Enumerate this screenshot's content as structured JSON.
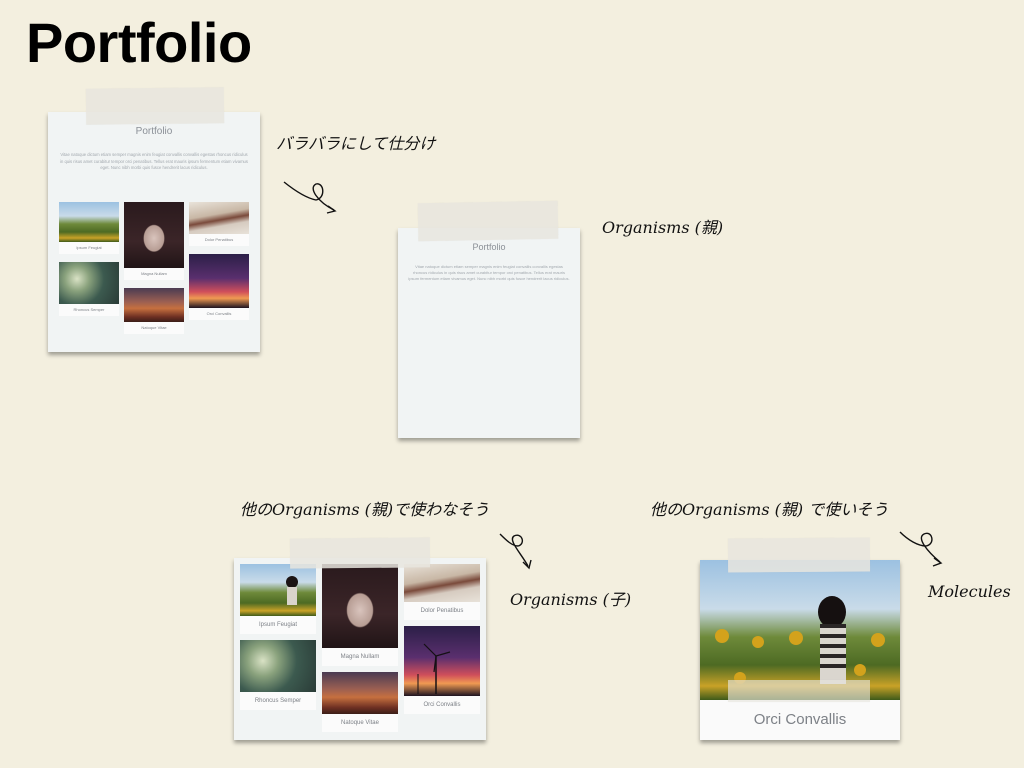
{
  "slide": {
    "title": "Portfolio"
  },
  "notes": {
    "separate": "バラバラにして仕分け",
    "organisms_parent": "Organisms (親)",
    "not_used_elsewhere": "他のOrganisms (親)で使わなそう",
    "organisms_child": "Organisms (子)",
    "used_elsewhere": "他のOrganisms (親) で使いそう",
    "molecules": "Molecules"
  },
  "card": {
    "title": "Portfolio",
    "body": "Vitae natoque dictum etiam semper magnis enim feugiat convallis convallis egestas rhoncus ridiculus in quis risus amet curabitur tempor orci penatibus. Tellus erat mauris ipsum fermentum etiam vivamus eget. Nunc nibh morbi quis fusce hendrerit lacus ridiculus."
  },
  "gallery": {
    "captions": [
      "Ipsum Feugiat",
      "Magna Nullam",
      "Dolor Penatibus",
      "Rhoncus Semper",
      "Natoque Vitae",
      "Orci Convallis"
    ]
  },
  "molecule": {
    "caption": "Orci Convallis"
  },
  "colors": {
    "background": "#f3efdf",
    "card": "#f1f4f4",
    "tape": "#e8e5de"
  }
}
